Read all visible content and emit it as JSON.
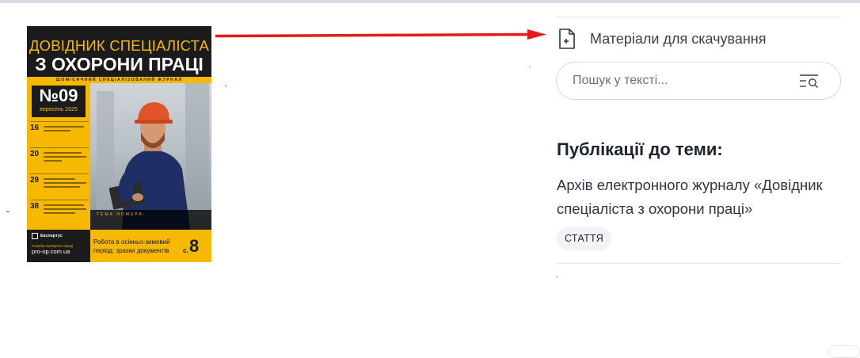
{
  "cover": {
    "title_line1": "ДОВІДНИК СПЕЦІАЛІСТА",
    "title_line2": "З ОХОРОНИ ПРАЦІ",
    "subtitle": "ЩОМІСЯЧНИЙ СПЕЦІАЛІЗОВАНИЙ ЖУРНАЛ",
    "issue_number": "№09",
    "issue_date": "вересень 2025",
    "contents": [
      {
        "page": "16"
      },
      {
        "page": "20"
      },
      {
        "page": "29"
      },
      {
        "page": "38"
      }
    ],
    "theme_label": "ТЕМА НОМЕРА:",
    "publisher": "Експертус",
    "site_note": "Служба експертної праці",
    "site": "pro-op.com.ua",
    "feature_article": "Робота в осінньо-зимовий період: зразки документів",
    "feature_page_label": "с.",
    "feature_page": "8",
    "colors": {
      "accent": "#f6b800",
      "dark": "#1b1b1b",
      "helmet": "#e2542a"
    }
  },
  "annotation": {
    "arrow_color": "#e31b1b",
    "icon": "arrow-right-icon"
  },
  "sidebar": {
    "materials_label": "Матеріали для скачування",
    "materials_icon": "file-plus-icon",
    "search_placeholder": "Пошук у тексті...",
    "search_icon": "text-search-icon",
    "publications_title": "Публікації до теми:",
    "publications": [
      {
        "title": "Архів електронного журналу «Довідник спеціаліста з охорони праці»",
        "badge": "СТАТТЯ"
      }
    ]
  }
}
